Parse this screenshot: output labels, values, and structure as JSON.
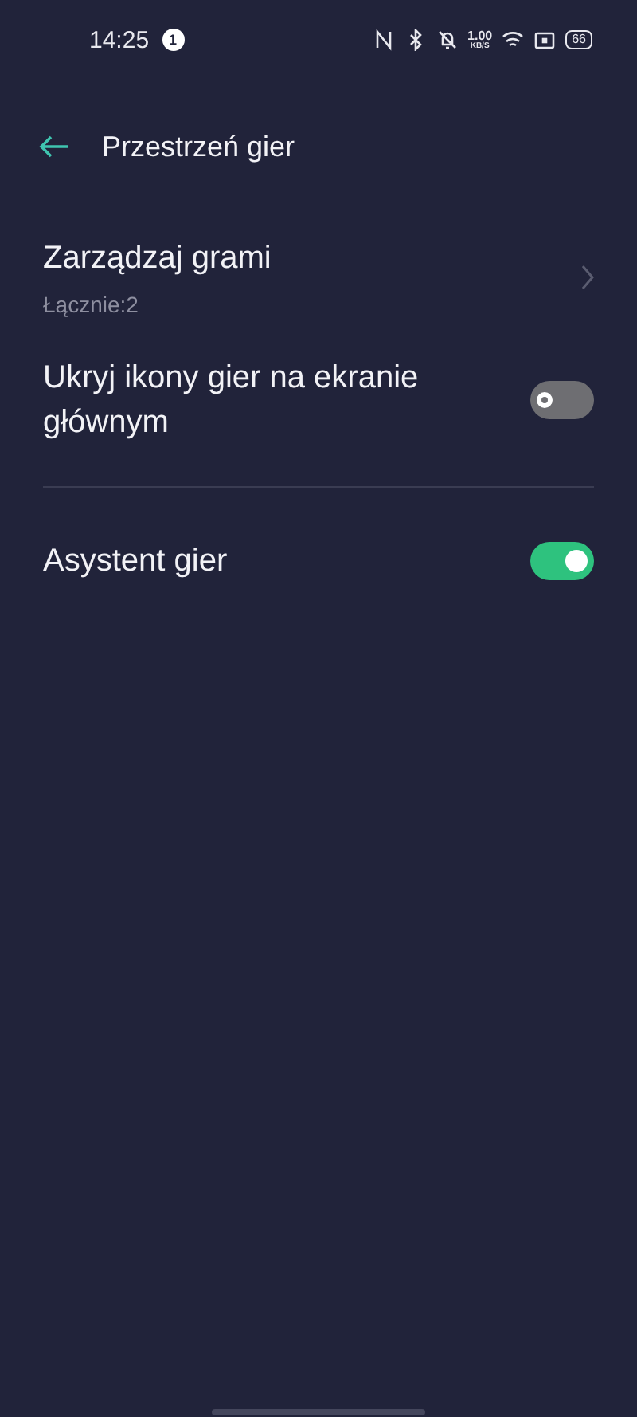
{
  "status_bar": {
    "time": "14:25",
    "notification_count": "1",
    "net_speed": "1.00",
    "net_unit": "KB/S",
    "battery": "66"
  },
  "header": {
    "title": "Przestrzeń gier"
  },
  "sections": [
    {
      "items": [
        {
          "kind": "link",
          "title": "Zarządzaj grami",
          "subtitle": "Łącznie:2"
        },
        {
          "kind": "toggle",
          "title": "Ukryj ikony gier na ekranie głównym",
          "on": false
        }
      ]
    },
    {
      "items": [
        {
          "kind": "toggle",
          "title": "Asystent gier",
          "on": true
        }
      ]
    }
  ]
}
